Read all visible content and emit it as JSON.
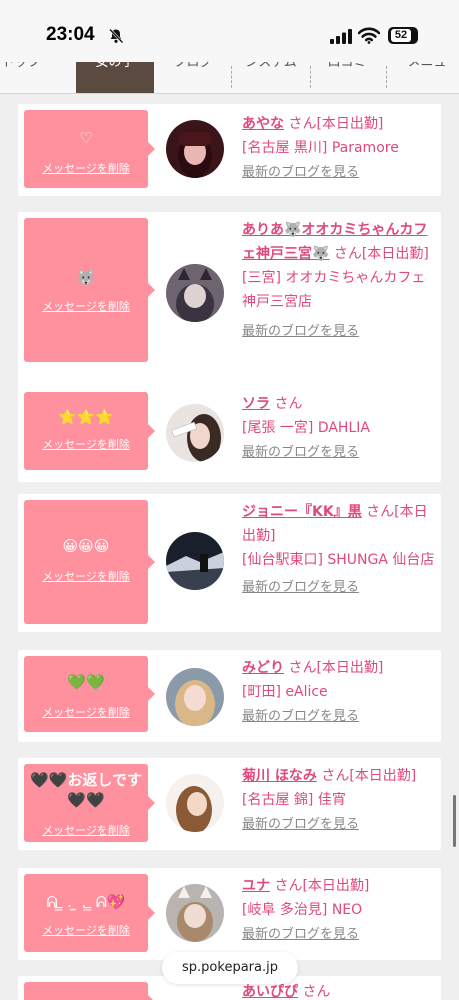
{
  "status": {
    "time": "23:04",
    "battery": "52"
  },
  "tabs": [
    {
      "label": "トップ"
    },
    {
      "label": "女の子"
    },
    {
      "label": "ブログ"
    },
    {
      "label": "システム"
    },
    {
      "label": "口コミ"
    },
    {
      "label": "メニュ"
    }
  ],
  "cards": [
    {
      "message": "♡",
      "delete_label": "メッセージを削除",
      "name": "あやな",
      "san": "さん",
      "status": "[本日出勤]",
      "shop": "[名古屋 黒川] Paramore",
      "blog": "最新のブログを見る"
    },
    {
      "message": "🐺",
      "delete_label": "メッセージを削除",
      "name": "ありあ🐺オオカミちゃんカフェ神戸三宮🐺",
      "san": "さん",
      "status": "[本日出勤]",
      "shop": "[三宮] オオカミちゃんカフェ神戸三宮店",
      "blog": "最新のブログを見る"
    },
    {
      "message": "⭐⭐⭐",
      "delete_label": "メッセージを削除",
      "name": "ソラ",
      "san": "さん",
      "status": "",
      "shop": "[尾張 一宮] DAHLIA",
      "blog": "最新のブログを見る"
    },
    {
      "message": "😀😀😀",
      "delete_label": "メッセージを削除",
      "name": "ジョニー『KK』黒",
      "san": "さん",
      "status": "[本日出勤]",
      "shop": "[仙台駅東口] SHUNGA 仙台店",
      "blog": "最新のブログを見る"
    },
    {
      "message": "💚💚",
      "delete_label": "メッセージを削除",
      "name": "みどり",
      "san": "さん",
      "status": "[本日出勤]",
      "shop": "[町田] eAlice",
      "blog": "最新のブログを見る"
    },
    {
      "message": "🖤🖤お返しです🖤🖤",
      "delete_label": "メッセージを削除",
      "name": "菊川 ほなみ",
      "san": "さん",
      "status": "[本日出勤]",
      "shop": "[名古屋 錦] 佳宵",
      "blog": "最新のブログを見る"
    },
    {
      "message": "ᕱ ̳ . ̫ . ̳ ᕱ💖",
      "delete_label": "メッセージを削除",
      "name": "ユナ",
      "san": "さん",
      "status": "[本日出勤]",
      "shop": "[岐阜 多治見] NEO",
      "blog": "最新のブログを見る"
    },
    {
      "message": "",
      "delete_label": "",
      "name": "あいぴぴ",
      "san": "さん",
      "status": "",
      "shop": "",
      "blog": ""
    }
  ],
  "url_bar": {
    "text": "sp.pokepara.jp"
  },
  "colors": {
    "accent": "#e04a7a",
    "message_bg": "#ff909e",
    "active_tab": "#5a4a40"
  }
}
